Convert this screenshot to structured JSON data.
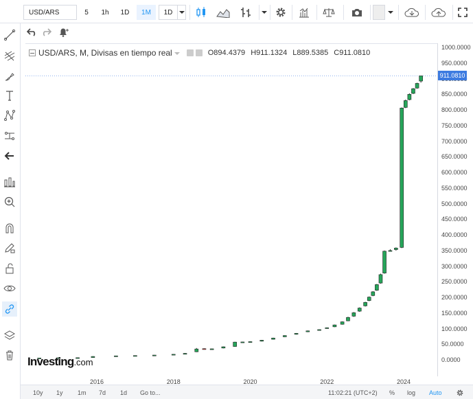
{
  "toolbar": {
    "symbol": "USD/ARS",
    "intervals": [
      "5",
      "1h",
      "1D",
      "1M"
    ],
    "active_interval": "1M",
    "range": "1D"
  },
  "legend": {
    "title": "USD/ARS, M, Divisas en tiempo real",
    "open_label": "O",
    "open": "894.4379",
    "high_label": "H",
    "high": "911.1324",
    "low_label": "L",
    "low": "889.5385",
    "close_label": "C",
    "close": "911.0810"
  },
  "price_tag": "911.0810",
  "logo": {
    "brand": "Investing",
    "suffix": ".com"
  },
  "bottombar": {
    "ranges": [
      "10y",
      "1y",
      "1m",
      "7d",
      "1d"
    ],
    "goto": "Go to...",
    "clock": "11:02:21 (UTC+2)",
    "percent": "%",
    "log": "log",
    "auto": "Auto"
  },
  "colors": {
    "up": "#26a55a",
    "down": "#e53935",
    "accent": "#2196f3",
    "price_tag": "#3d7be0"
  },
  "chart_data": {
    "type": "candlestick",
    "title": "USD/ARS, M, Divisas en tiempo real",
    "ylim": [
      0,
      1000
    ],
    "y_ticks": [
      "1000.0000",
      "950.0000",
      "900.0000",
      "850.0000",
      "800.0000",
      "750.0000",
      "700.0000",
      "650.0000",
      "600.0000",
      "550.0000",
      "500.0000",
      "450.0000",
      "400.0000",
      "350.0000",
      "300.0000",
      "250.0000",
      "200.0000",
      "150.0000",
      "100.0000",
      "50.0000",
      "0.0000"
    ],
    "x_ticks": [
      "2016",
      "2018",
      "2020",
      "2022",
      "2024"
    ],
    "x_range": [
      2014.2,
      2024.9
    ],
    "last_price": 911.081,
    "candles": [
      {
        "t": 2014.5,
        "o": 8.1,
        "h": 8.3,
        "l": 8.0,
        "c": 8.2
      },
      {
        "t": 2015.0,
        "o": 8.6,
        "h": 8.9,
        "l": 8.5,
        "c": 8.8
      },
      {
        "t": 2015.5,
        "o": 9.0,
        "h": 9.3,
        "l": 8.9,
        "c": 9.2
      },
      {
        "t": 2015.9,
        "o": 9.7,
        "h": 13.8,
        "l": 9.6,
        "c": 13.0
      },
      {
        "t": 2016.5,
        "o": 14.0,
        "h": 15.5,
        "l": 13.5,
        "c": 15.0
      },
      {
        "t": 2017.0,
        "o": 15.2,
        "h": 16.5,
        "l": 15.0,
        "c": 16.0
      },
      {
        "t": 2017.5,
        "o": 16.8,
        "h": 17.8,
        "l": 16.5,
        "c": 17.5
      },
      {
        "t": 2018.0,
        "o": 18.5,
        "h": 20.5,
        "l": 18.3,
        "c": 20.0
      },
      {
        "t": 2018.3,
        "o": 20.2,
        "h": 24.0,
        "l": 20.0,
        "c": 23.0
      },
      {
        "t": 2018.6,
        "o": 28.0,
        "h": 40.0,
        "l": 27.0,
        "c": 37.0
      },
      {
        "t": 2018.8,
        "o": 38.0,
        "h": 39.0,
        "l": 35.0,
        "c": 36.0
      },
      {
        "t": 2019.0,
        "o": 37.0,
        "h": 38.0,
        "l": 36.5,
        "c": 37.5
      },
      {
        "t": 2019.3,
        "o": 40.0,
        "h": 45.0,
        "l": 39.0,
        "c": 44.0
      },
      {
        "t": 2019.6,
        "o": 45.0,
        "h": 60.0,
        "l": 44.0,
        "c": 59.0
      },
      {
        "t": 2019.8,
        "o": 59.0,
        "h": 60.0,
        "l": 58.0,
        "c": 59.5
      },
      {
        "t": 2020.0,
        "o": 60.0,
        "h": 61.0,
        "l": 59.5,
        "c": 60.5
      },
      {
        "t": 2020.3,
        "o": 62.0,
        "h": 66.0,
        "l": 61.0,
        "c": 65.0
      },
      {
        "t": 2020.6,
        "o": 68.0,
        "h": 73.0,
        "l": 67.0,
        "c": 72.0
      },
      {
        "t": 2020.9,
        "o": 76.0,
        "h": 81.0,
        "l": 75.0,
        "c": 80.0
      },
      {
        "t": 2021.2,
        "o": 84.0,
        "h": 88.0,
        "l": 83.0,
        "c": 87.0
      },
      {
        "t": 2021.5,
        "o": 92.0,
        "h": 96.0,
        "l": 91.0,
        "c": 95.0
      },
      {
        "t": 2021.8,
        "o": 97.0,
        "h": 100.0,
        "l": 96.0,
        "c": 99.0
      },
      {
        "t": 2022.0,
        "o": 103.0,
        "h": 106.0,
        "l": 102.0,
        "c": 105.0
      },
      {
        "t": 2022.2,
        "o": 108.0,
        "h": 115.0,
        "l": 107.0,
        "c": 114.0
      },
      {
        "t": 2022.4,
        "o": 116.0,
        "h": 125.0,
        "l": 115.0,
        "c": 124.0
      },
      {
        "t": 2022.55,
        "o": 127.0,
        "h": 140.0,
        "l": 126.0,
        "c": 138.0
      },
      {
        "t": 2022.7,
        "o": 142.0,
        "h": 155.0,
        "l": 140.0,
        "c": 153.0
      },
      {
        "t": 2022.85,
        "o": 158.0,
        "h": 170.0,
        "l": 156.0,
        "c": 168.0
      },
      {
        "t": 2023.0,
        "o": 175.0,
        "h": 188.0,
        "l": 173.0,
        "c": 186.0
      },
      {
        "t": 2023.1,
        "o": 192.0,
        "h": 205.0,
        "l": 190.0,
        "c": 203.0
      },
      {
        "t": 2023.2,
        "o": 208.0,
        "h": 222.0,
        "l": 206.0,
        "c": 220.0
      },
      {
        "t": 2023.3,
        "o": 225.0,
        "h": 245.0,
        "l": 223.0,
        "c": 243.0
      },
      {
        "t": 2023.4,
        "o": 248.0,
        "h": 278.0,
        "l": 246.0,
        "c": 275.0
      },
      {
        "t": 2023.5,
        "o": 280.0,
        "h": 352.0,
        "l": 278.0,
        "c": 350.0
      },
      {
        "t": 2023.65,
        "o": 350.0,
        "h": 356.0,
        "l": 349.0,
        "c": 352.0
      },
      {
        "t": 2023.8,
        "o": 355.0,
        "h": 362.0,
        "l": 352.0,
        "c": 360.0
      },
      {
        "t": 2023.95,
        "o": 362.0,
        "h": 810.0,
        "l": 360.0,
        "c": 808.0
      },
      {
        "t": 2024.05,
        "o": 810.0,
        "h": 835.0,
        "l": 808.0,
        "c": 832.0
      },
      {
        "t": 2024.15,
        "o": 835.0,
        "h": 855.0,
        "l": 833.0,
        "c": 852.0
      },
      {
        "t": 2024.25,
        "o": 855.0,
        "h": 872.0,
        "l": 853.0,
        "c": 870.0
      },
      {
        "t": 2024.35,
        "o": 872.0,
        "h": 889.0,
        "l": 870.0,
        "c": 887.0
      },
      {
        "t": 2024.45,
        "o": 894.4379,
        "h": 911.1324,
        "l": 889.5385,
        "c": 911.081
      }
    ]
  }
}
